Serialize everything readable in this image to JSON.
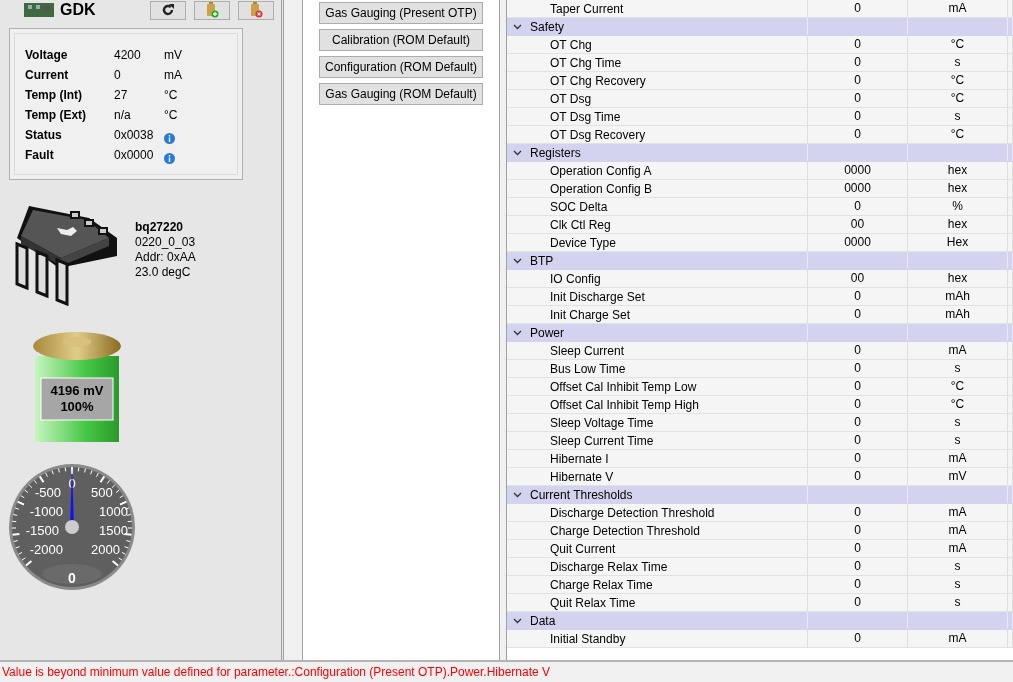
{
  "device_header": {
    "title": "GDK",
    "buttons": [
      {
        "kind": "refresh"
      },
      {
        "kind": "battery-add"
      },
      {
        "kind": "battery-remove"
      }
    ]
  },
  "readings": [
    {
      "label": "Voltage",
      "value": "4200",
      "unit": "mV"
    },
    {
      "label": "Current",
      "value": "0",
      "unit": "mA"
    },
    {
      "label": "Temp (Int)",
      "value": "27",
      "unit": "°C"
    },
    {
      "label": "Temp (Ext)",
      "value": "n/a",
      "unit": "°C"
    },
    {
      "label": "Status",
      "value": "0x0038",
      "info": true
    },
    {
      "label": "Fault",
      "value": "0x0000",
      "info": true
    }
  ],
  "chip": {
    "name": "bq27220",
    "firmware": "0220_0_03",
    "address": "Addr: 0xAA",
    "temperature": "23.0 degC"
  },
  "battery": {
    "voltage": "4196 mV",
    "percent": "100%",
    "level": 1
  },
  "gauge": {
    "left_labels": [
      "-500",
      "-1000",
      "-1500",
      "-2000"
    ],
    "right_labels": [
      "500",
      "1000",
      "1500",
      "2000"
    ],
    "top_label": "0",
    "reading": "0",
    "level": 0.5
  },
  "sections": [
    "Gas Gauging (Present OTP)",
    "Calibration (ROM Default)",
    "Configuration (ROM Default)",
    "Gas Gauging (ROM Default)"
  ],
  "table": {
    "rows": [
      {
        "kind": "param",
        "name": "Taper Current",
        "value": "0",
        "unit": "mA"
      },
      {
        "kind": "group",
        "name": "Safety",
        "expanded": true
      },
      {
        "kind": "param",
        "name": "OT Chg",
        "value": "0",
        "unit": "°C"
      },
      {
        "kind": "param",
        "name": "OT Chg Time",
        "value": "0",
        "unit": "s"
      },
      {
        "kind": "param",
        "name": "OT Chg Recovery",
        "value": "0",
        "unit": "°C"
      },
      {
        "kind": "param",
        "name": "OT Dsg",
        "value": "0",
        "unit": "°C"
      },
      {
        "kind": "param",
        "name": "OT Dsg Time",
        "value": "0",
        "unit": "s"
      },
      {
        "kind": "param",
        "name": "OT Dsg Recovery",
        "value": "0",
        "unit": "°C"
      },
      {
        "kind": "group",
        "name": "Registers",
        "expanded": true
      },
      {
        "kind": "param",
        "name": "Operation Config A",
        "value": "0000",
        "unit": "hex"
      },
      {
        "kind": "param",
        "name": "Operation Config B",
        "value": "0000",
        "unit": "hex"
      },
      {
        "kind": "param",
        "name": "SOC Delta",
        "value": "0",
        "unit": "%"
      },
      {
        "kind": "param",
        "name": "Clk Ctl Reg",
        "value": "00",
        "unit": "hex"
      },
      {
        "kind": "param",
        "name": "Device Type",
        "value": "0000",
        "unit": "Hex"
      },
      {
        "kind": "group",
        "name": "BTP",
        "expanded": true
      },
      {
        "kind": "param",
        "name": "IO Config",
        "value": "00",
        "unit": "hex"
      },
      {
        "kind": "param",
        "name": "Init Discharge Set",
        "value": "0",
        "unit": "mAh"
      },
      {
        "kind": "param",
        "name": "Init Charge Set",
        "value": "0",
        "unit": "mAh"
      },
      {
        "kind": "group",
        "name": "Power",
        "expanded": true
      },
      {
        "kind": "param",
        "name": "Sleep Current",
        "value": "0",
        "unit": "mA"
      },
      {
        "kind": "param",
        "name": "Bus Low Time",
        "value": "0",
        "unit": "s"
      },
      {
        "kind": "param",
        "name": "Offset Cal Inhibit Temp Low",
        "value": "0",
        "unit": "°C"
      },
      {
        "kind": "param",
        "name": "Offset Cal Inhibit Temp High",
        "value": "0",
        "unit": "°C"
      },
      {
        "kind": "param",
        "name": "Sleep Voltage Time",
        "value": "0",
        "unit": "s"
      },
      {
        "kind": "param",
        "name": "Sleep Current Time",
        "value": "0",
        "unit": "s"
      },
      {
        "kind": "param",
        "name": "Hibernate I",
        "value": "0",
        "unit": "mA"
      },
      {
        "kind": "param",
        "name": "Hibernate V",
        "value": "0",
        "unit": "mV"
      },
      {
        "kind": "group",
        "name": "Current Thresholds",
        "expanded": true
      },
      {
        "kind": "param",
        "name": "Discharge Detection Threshold",
        "value": "0",
        "unit": "mA"
      },
      {
        "kind": "param",
        "name": "Charge Detection Threshold",
        "value": "0",
        "unit": "mA"
      },
      {
        "kind": "param",
        "name": "Quit Current",
        "value": "0",
        "unit": "mA"
      },
      {
        "kind": "param",
        "name": "Discharge Relax Time",
        "value": "0",
        "unit": "s"
      },
      {
        "kind": "param",
        "name": "Charge Relax Time",
        "value": "0",
        "unit": "s"
      },
      {
        "kind": "param",
        "name": "Quit Relax Time",
        "value": "0",
        "unit": "s"
      },
      {
        "kind": "group",
        "name": "Data",
        "expanded": true
      },
      {
        "kind": "param",
        "name": "Initial Standby",
        "value": "0",
        "unit": "mA"
      }
    ]
  },
  "status_bar": {
    "message": "Value is beyond minimum value defined for parameter.:Configuration (Present OTP).Power.Hibernate V"
  }
}
